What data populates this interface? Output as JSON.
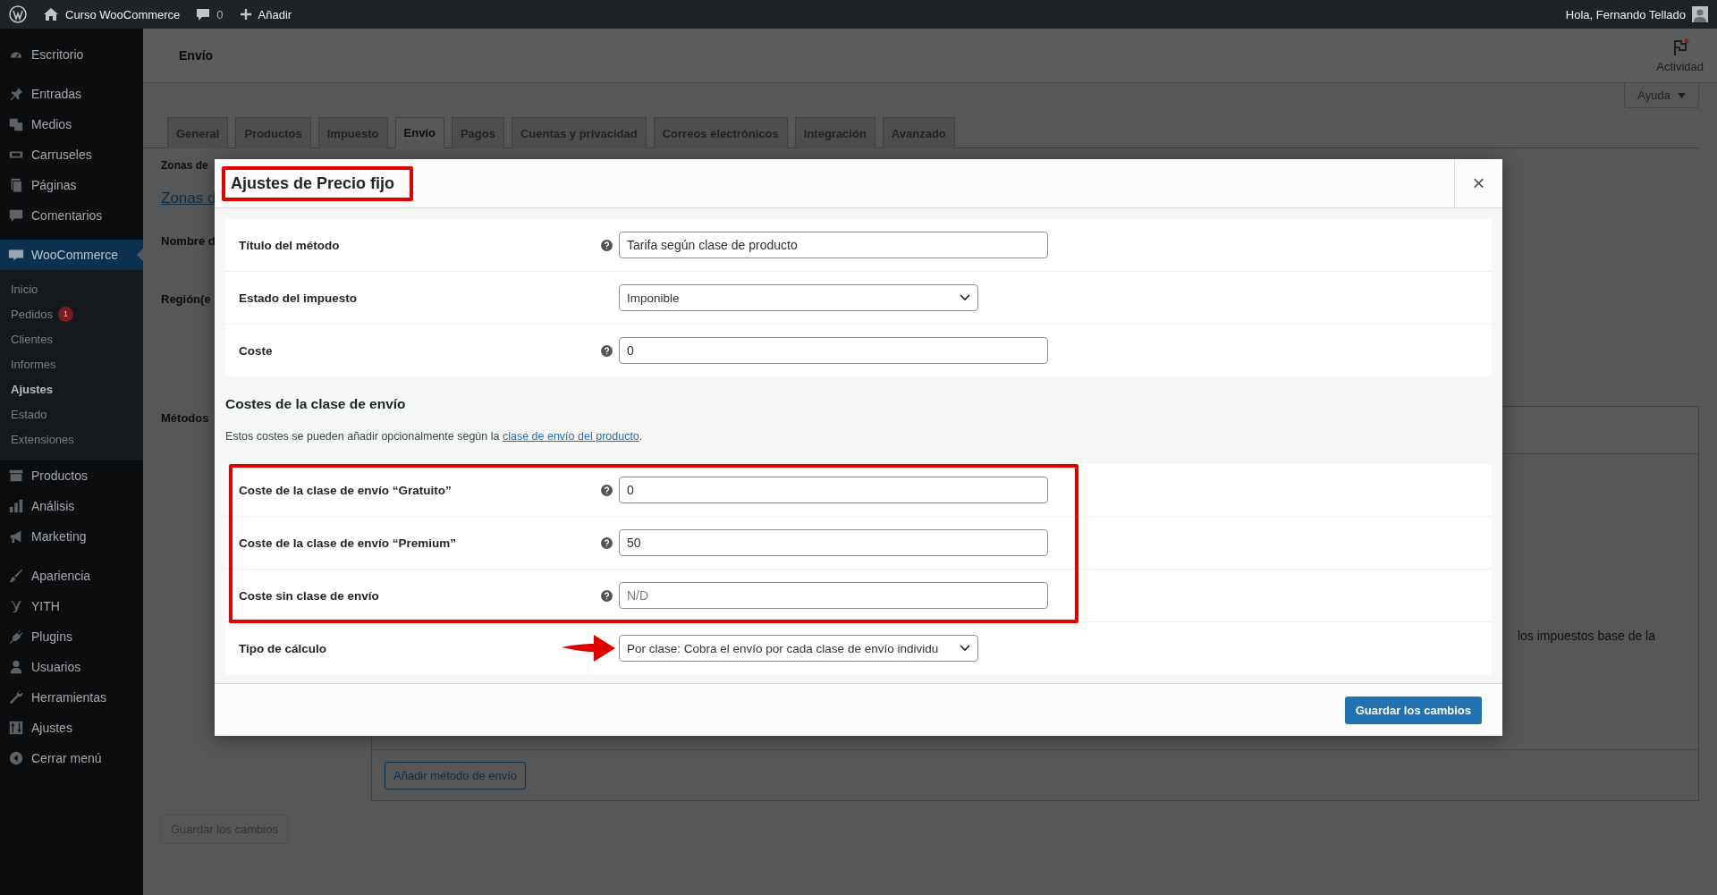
{
  "admin_bar": {
    "site": "Curso WooCommerce",
    "comments": "0",
    "new": "Añadir",
    "greeting": "Hola, Fernando Tellado"
  },
  "sidebar": {
    "sections": [
      [
        {
          "label": "Escritorio",
          "selected": false
        }
      ],
      [
        {
          "label": "Entradas",
          "selected": false
        },
        {
          "label": "Medios",
          "selected": false
        },
        {
          "label": "Carruseles",
          "selected": false
        },
        {
          "label": "Páginas",
          "selected": false
        },
        {
          "label": "Comentarios",
          "selected": false
        }
      ],
      [
        {
          "label": "WooCommerce",
          "selected": true,
          "submenu": [
            {
              "label": "Inicio",
              "selected": false
            },
            {
              "label": "Pedidos",
              "selected": false,
              "badge": "1"
            },
            {
              "label": "Clientes",
              "selected": false
            },
            {
              "label": "Informes",
              "selected": false
            },
            {
              "label": "Ajustes",
              "selected": true
            },
            {
              "label": "Estado",
              "selected": false
            },
            {
              "label": "Extensiones",
              "selected": false
            }
          ]
        },
        {
          "label": "Productos",
          "selected": false
        },
        {
          "label": "Análisis",
          "selected": false
        },
        {
          "label": "Marketing",
          "selected": false
        }
      ],
      [
        {
          "label": "Apariencia",
          "selected": false
        },
        {
          "label": "YITH",
          "selected": false
        },
        {
          "label": "Plugins",
          "selected": false
        },
        {
          "label": "Usuarios",
          "selected": false
        },
        {
          "label": "Herramientas",
          "selected": false
        },
        {
          "label": "Ajustes",
          "selected": false
        },
        {
          "label": "Cerrar menú",
          "selected": false
        }
      ]
    ]
  },
  "header": {
    "title": "Envío",
    "activity": "Actividad",
    "help": "Ayuda"
  },
  "tabs": [
    {
      "label": "General",
      "selected": false
    },
    {
      "label": "Productos",
      "selected": false
    },
    {
      "label": "Impuesto",
      "selected": false
    },
    {
      "label": "Envío",
      "selected": true
    },
    {
      "label": "Pagos",
      "selected": false
    },
    {
      "label": "Cuentas y privacidad",
      "selected": false
    },
    {
      "label": "Correos electrónicos",
      "selected": false
    },
    {
      "label": "Integración",
      "selected": false
    },
    {
      "label": "Avanzado",
      "selected": false
    }
  ],
  "background": {
    "subnav": "Zonas de",
    "zone_link": "Zonas d",
    "labels": [
      "Nombre d",
      "Región(e",
      "Métodos"
    ],
    "methods_text": "los impuestos base de la",
    "add_method": "Añadir método de envío",
    "save": "Guardar los cambios"
  },
  "modal": {
    "title": "Ajustes de Precio fijo",
    "close": "×",
    "fields": [
      {
        "kind": "text",
        "label": "Título del método",
        "help": true,
        "value": "Tarifa según clase de producto"
      },
      {
        "kind": "select",
        "label": "Estado del impuesto",
        "help": false,
        "value": "Imponible"
      },
      {
        "kind": "text",
        "label": "Coste",
        "help": true,
        "value": "0"
      }
    ],
    "section_title": "Costes de la clase de envío",
    "description": "Estos costes se pueden añadir opcionalmente según la ",
    "description_link": "clase de envío del producto",
    "description_end": ".",
    "class_fields": [
      {
        "kind": "text",
        "label": "Coste de la clase de envío “Gratuito”",
        "help": true,
        "value": "0"
      },
      {
        "kind": "text",
        "label": "Coste de la clase de envío “Premium”",
        "help": true,
        "value": "50"
      },
      {
        "kind": "text",
        "label": "Coste sin clase de envío",
        "help": true,
        "placeholder": "N/D"
      }
    ],
    "calc_field": {
      "kind": "select",
      "label": "Tipo de cálculo",
      "help": false,
      "value": "Por clase: Cobra el envío por cada clase de envío individu"
    },
    "save": "Guardar los cambios"
  }
}
